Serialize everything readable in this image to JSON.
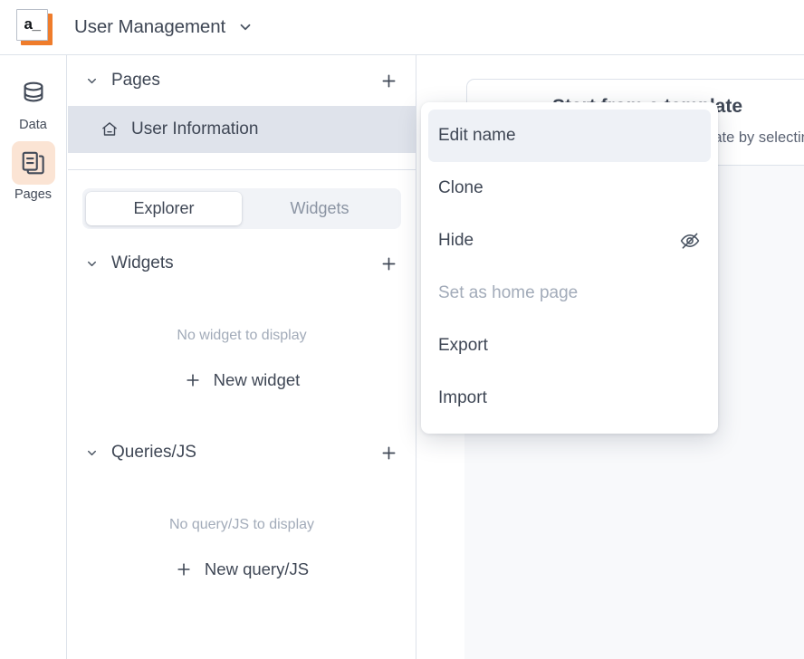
{
  "header": {
    "logo_text": "a_",
    "title": "User Management",
    "chevron_icon": "chevron-down-icon",
    "accent_color": "#ef7c2b"
  },
  "rail": {
    "items": [
      {
        "label": "Data",
        "icon": "database-icon",
        "active": false
      },
      {
        "label": "Pages",
        "icon": "pages-stack-icon",
        "active": true
      }
    ],
    "active_background": "#fbe4d4"
  },
  "panel": {
    "pages_section": {
      "title": "Pages",
      "collapse_icon": "chevron-down-icon",
      "add_icon": "plus-icon",
      "page": {
        "label": "User Information",
        "icon": "home-icon",
        "selected": true,
        "selected_background": "#dfe3eb"
      }
    },
    "tabs": [
      {
        "label": "Explorer",
        "active": true
      },
      {
        "label": "Widgets",
        "active": false
      }
    ],
    "widgets_section": {
      "title": "Widgets",
      "collapse_icon": "chevron-down-icon",
      "add_icon": "plus-icon",
      "empty_text": "No widget to display",
      "new_label": "New widget",
      "new_icon": "plus-icon"
    },
    "queries_section": {
      "title": "Queries/JS",
      "collapse_icon": "chevron-down-icon",
      "add_icon": "plus-icon",
      "empty_text": "No query/JS to display",
      "new_label": "New query/JS",
      "new_icon": "plus-icon"
    }
  },
  "canvas": {
    "template_card": {
      "title": "Start from a template",
      "subtitle": "Start building your app from a template by selecting"
    }
  },
  "context_menu": {
    "items": [
      {
        "label": "Edit name",
        "state": "hover",
        "icon": null
      },
      {
        "label": "Clone",
        "state": "normal",
        "icon": null
      },
      {
        "label": "Hide",
        "state": "normal",
        "icon": "eye-off-icon"
      },
      {
        "label": "Set as home page",
        "state": "disabled",
        "icon": null
      },
      {
        "label": "Export",
        "state": "normal",
        "icon": null
      },
      {
        "label": "Import",
        "state": "normal",
        "icon": null
      }
    ],
    "hover_background": "#eef1f6"
  }
}
